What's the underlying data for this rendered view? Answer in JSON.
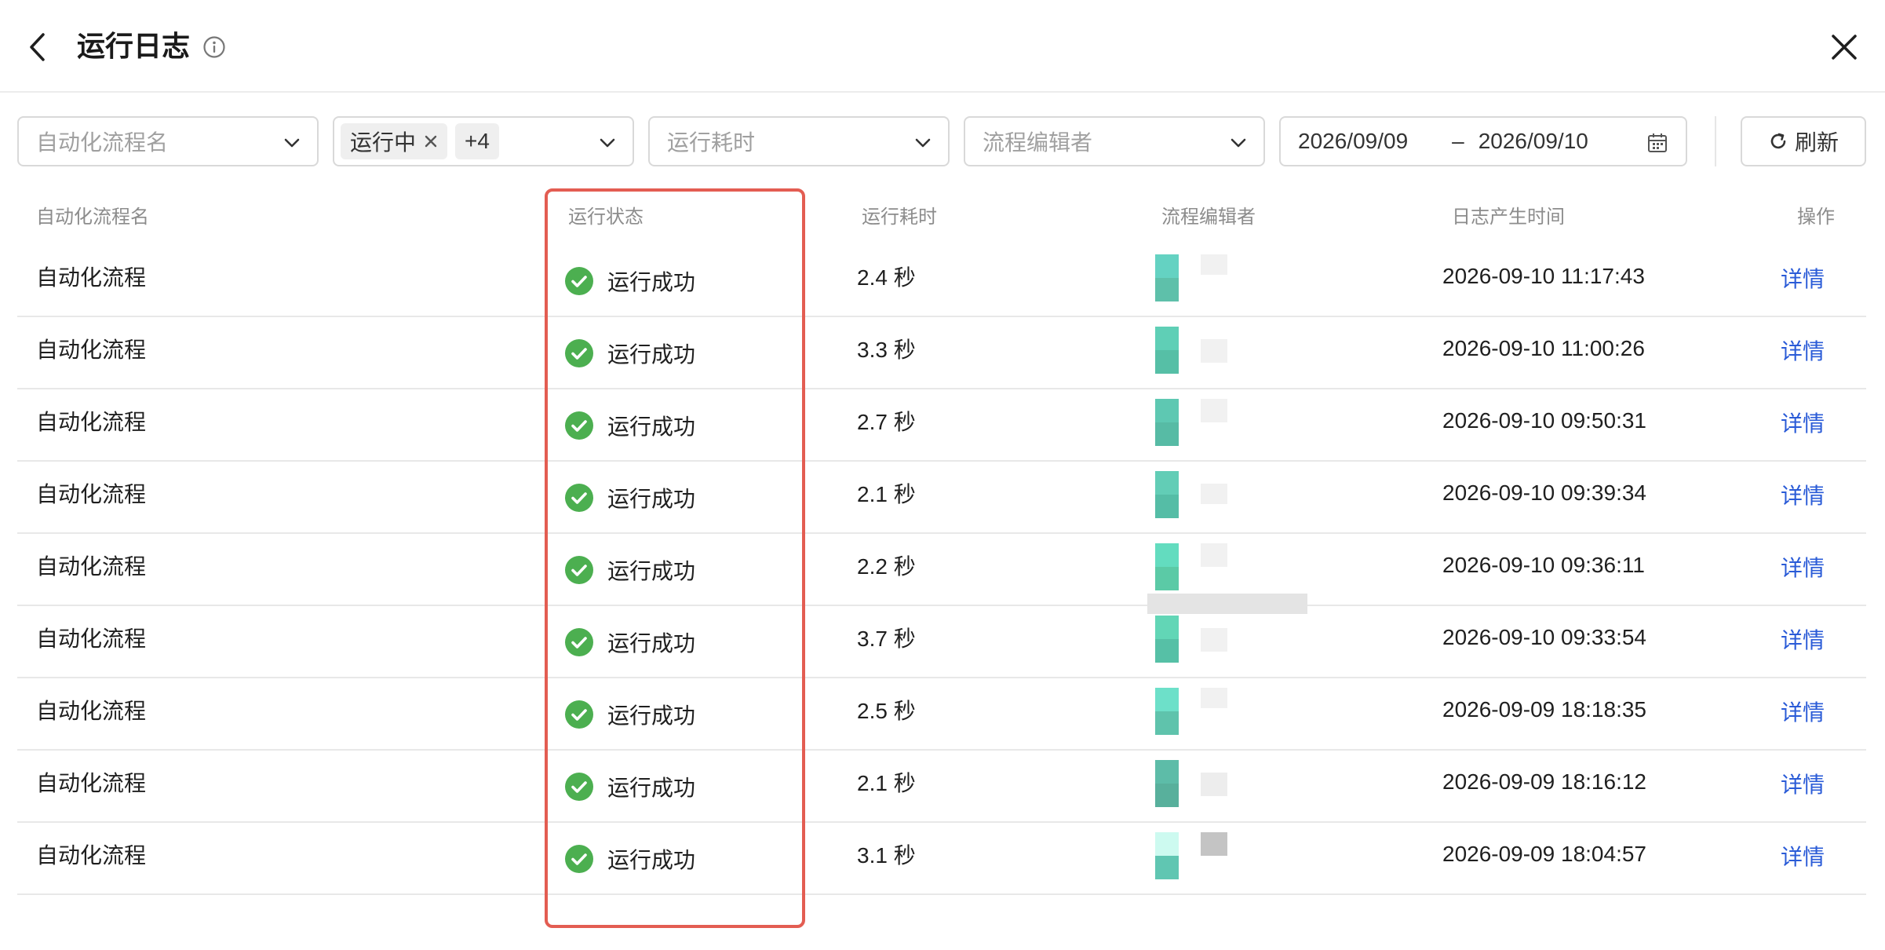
{
  "header": {
    "title": "运行日志"
  },
  "filters": {
    "flow_name_placeholder": "自动化流程名",
    "status_tag": "运行中",
    "status_more": "+4",
    "duration_placeholder": "运行耗时",
    "editor_placeholder": "流程编辑者",
    "date_start": "2026/09/09",
    "date_separator": "–",
    "date_end": "2026/09/10",
    "refresh_label": "刷新"
  },
  "table": {
    "columns": {
      "name": "自动化流程名",
      "status": "运行状态",
      "duration": "运行耗时",
      "editor": "流程编辑者",
      "time": "日志产生时间",
      "action": "操作"
    },
    "rows": [
      {
        "name": "自动化流程",
        "status": "运行成功",
        "duration": "2.4 秒",
        "time": "2026-09-10 11:17:43",
        "action": "详情"
      },
      {
        "name": "自动化流程",
        "status": "运行成功",
        "duration": "3.3 秒",
        "time": "2026-09-10 11:00:26",
        "action": "详情"
      },
      {
        "name": "自动化流程",
        "status": "运行成功",
        "duration": "2.7 秒",
        "time": "2026-09-10 09:50:31",
        "action": "详情"
      },
      {
        "name": "自动化流程",
        "status": "运行成功",
        "duration": "2.1 秒",
        "time": "2026-09-10 09:39:34",
        "action": "详情"
      },
      {
        "name": "自动化流程",
        "status": "运行成功",
        "duration": "2.2 秒",
        "time": "2026-09-10 09:36:11",
        "action": "详情"
      },
      {
        "name": "自动化流程",
        "status": "运行成功",
        "duration": "3.7 秒",
        "time": "2026-09-10 09:33:54",
        "action": "详情"
      },
      {
        "name": "自动化流程",
        "status": "运行成功",
        "duration": "2.5 秒",
        "time": "2026-09-09 18:18:35",
        "action": "详情"
      },
      {
        "name": "自动化流程",
        "status": "运行成功",
        "duration": "2.1 秒",
        "time": "2026-09-09 18:16:12",
        "action": "详情"
      },
      {
        "name": "自动化流程",
        "status": "运行成功",
        "duration": "3.1 秒",
        "time": "2026-09-09 18:04:57",
        "action": "详情"
      }
    ]
  },
  "colors": {
    "success": "#4caf50",
    "link": "#2a5bd7",
    "highlight": "#e35d52"
  }
}
